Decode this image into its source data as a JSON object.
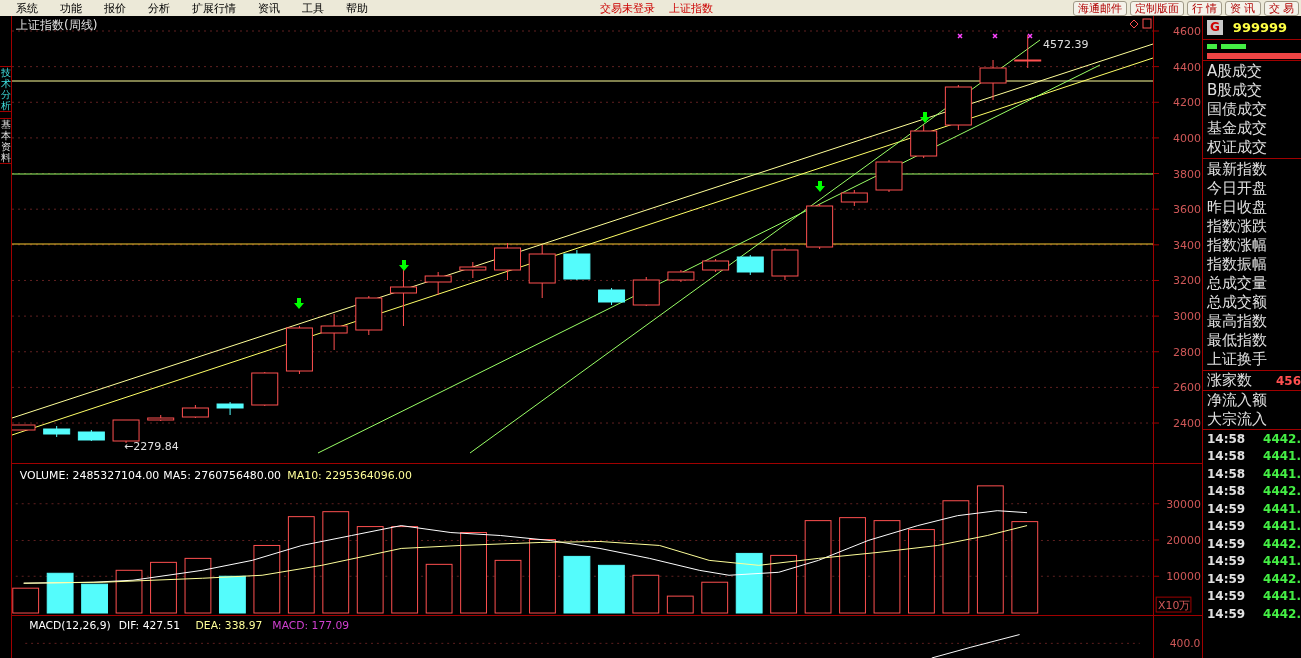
{
  "menu_bar": {
    "items": [
      "系统",
      "功能",
      "报价",
      "分析",
      "扩展行情",
      "资讯",
      "工具",
      "帮助"
    ],
    "status": [
      "交易未登录",
      "上证指数"
    ],
    "buttons": [
      "海通邮件",
      "定制版面",
      "行 情",
      "资 讯",
      "交 易"
    ]
  },
  "side_tabs": [
    {
      "label": "技术分析",
      "selected": true
    },
    {
      "label": "基本资料",
      "selected": false
    }
  ],
  "chart": {
    "title": "上证指数(周线)",
    "high_label": "4572.39",
    "low_label": "←2279.84",
    "price_axis": [
      "4600",
      "4400",
      "4200",
      "4000",
      "3800",
      "3600",
      "3400",
      "3200",
      "3000",
      "2800",
      "2600",
      "2400"
    ]
  },
  "volume": {
    "legend": [
      {
        "text": "VOLUME: 2485327104.00",
        "color": "#ffffff"
      },
      {
        "text": "MA5: 2760756480.00",
        "color": "#ffffff"
      },
      {
        "text": "MA10: 2295364096.00",
        "color": "#ffff99"
      }
    ],
    "axis": [
      "30000",
      "20000",
      "10000"
    ],
    "unit": "X10万"
  },
  "macd": {
    "legend": [
      {
        "text": "MACD(12,26,9)",
        "color": "#ffffff"
      },
      {
        "text": "DIF: 427.51",
        "color": "#ffffff"
      },
      {
        "text": "DEA: 338.97",
        "color": "#ffff99"
      },
      {
        "text": "MACD: 177.09",
        "color": "#d040d0"
      }
    ],
    "axis": [
      "400.0"
    ]
  },
  "quote_panel": {
    "badge": "G",
    "code": "999999",
    "field_groups": [
      [
        "A股成交",
        "B股成交",
        "国债成交",
        "基金成交",
        "权证成交"
      ],
      [
        "最新指数",
        "今日开盘",
        "昨日收盘",
        "指数涨跌",
        "指数涨幅",
        "指数振幅",
        "总成交量",
        "总成交额",
        "最高指数",
        "最低指数",
        "上证换手"
      ]
    ],
    "advancers": {
      "label": "涨家数",
      "value": "456"
    },
    "flows": [
      "净流入额",
      "大宗流入"
    ],
    "ticks": [
      {
        "time": "14:58",
        "price": "4442."
      },
      {
        "time": "14:58",
        "price": "4441."
      },
      {
        "time": "14:58",
        "price": "4441."
      },
      {
        "time": "14:58",
        "price": "4442."
      },
      {
        "time": "14:59",
        "price": "4441."
      },
      {
        "time": "14:59",
        "price": "4441."
      },
      {
        "time": "14:59",
        "price": "4442."
      },
      {
        "time": "14:59",
        "price": "4441."
      },
      {
        "time": "14:59",
        "price": "4442."
      },
      {
        "time": "14:59",
        "price": "4441."
      },
      {
        "time": "14:59",
        "price": "4442."
      }
    ]
  }
}
